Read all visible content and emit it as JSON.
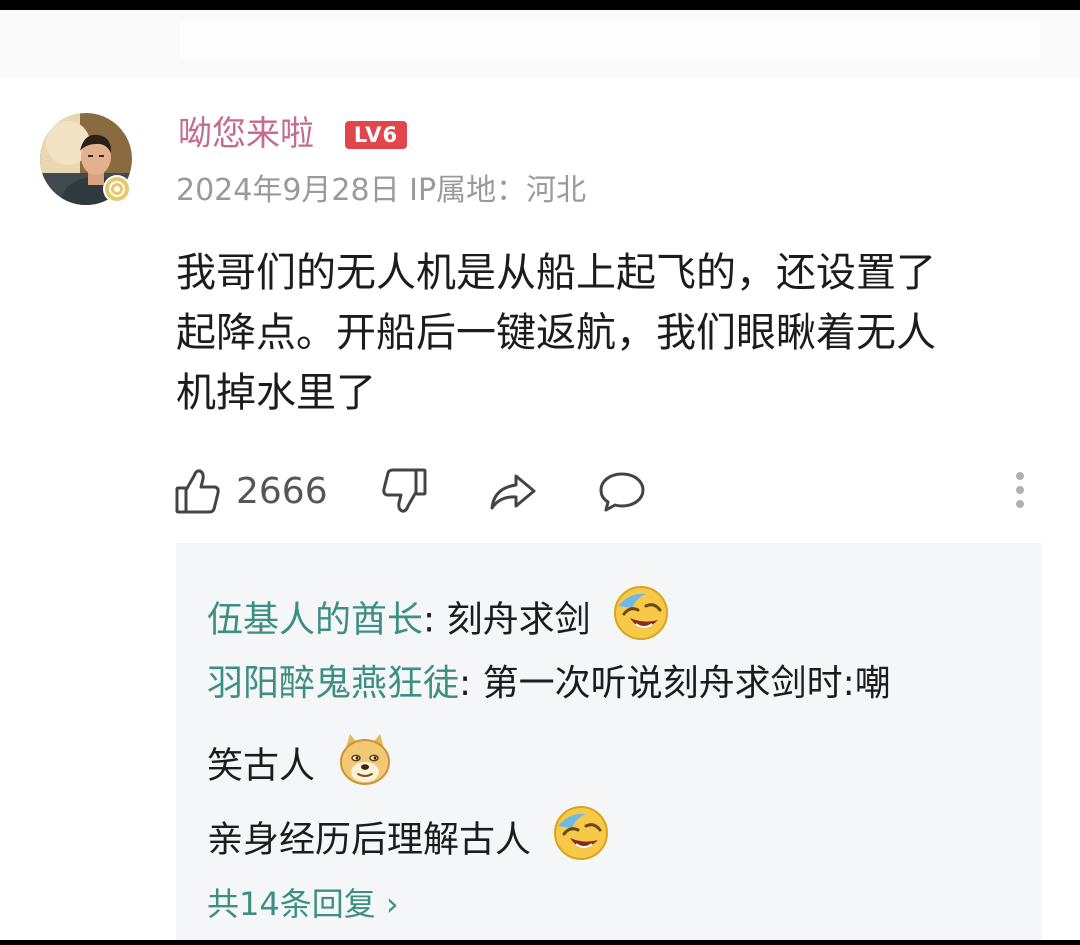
{
  "comment": {
    "username": "呦您来啦",
    "level_badge": "LV6",
    "date": "2024年9月28日",
    "ip_location": "IP属地：河北",
    "text_line1": "我哥们的无人机是从船上起飞的，还设置了",
    "text_line2": "起降点。开船后一键返航，我们眼瞅着无人",
    "text_line3": "机掉水里了",
    "like_count": "2666"
  },
  "replies": [
    {
      "author": "伍基人的酋长",
      "text": ": 刻舟求剑",
      "emoji": "laughing-crying-emoji"
    },
    {
      "author": "羽阳醉鬼燕狂徒",
      "text": ": 第一次听说刻舟求剑时:嘲",
      "continuation": "笑古人",
      "emoji": "doge-emoji"
    },
    {
      "author": "",
      "text": "亲身经历后理解古人",
      "emoji": "laughing-crying-emoji"
    }
  ],
  "more_replies_label": "共14条回复",
  "more_replies_chevron": "›",
  "icons": {
    "like": "thumbs-up-icon",
    "dislike": "thumbs-down-icon",
    "share": "share-icon",
    "reply": "comment-icon",
    "more": "more-vertical-icon"
  },
  "colors": {
    "username": "#c46b8e",
    "level_badge": "#e0464b",
    "reply_author": "#3d8f80",
    "reply_bg": "#f5f6f7"
  }
}
